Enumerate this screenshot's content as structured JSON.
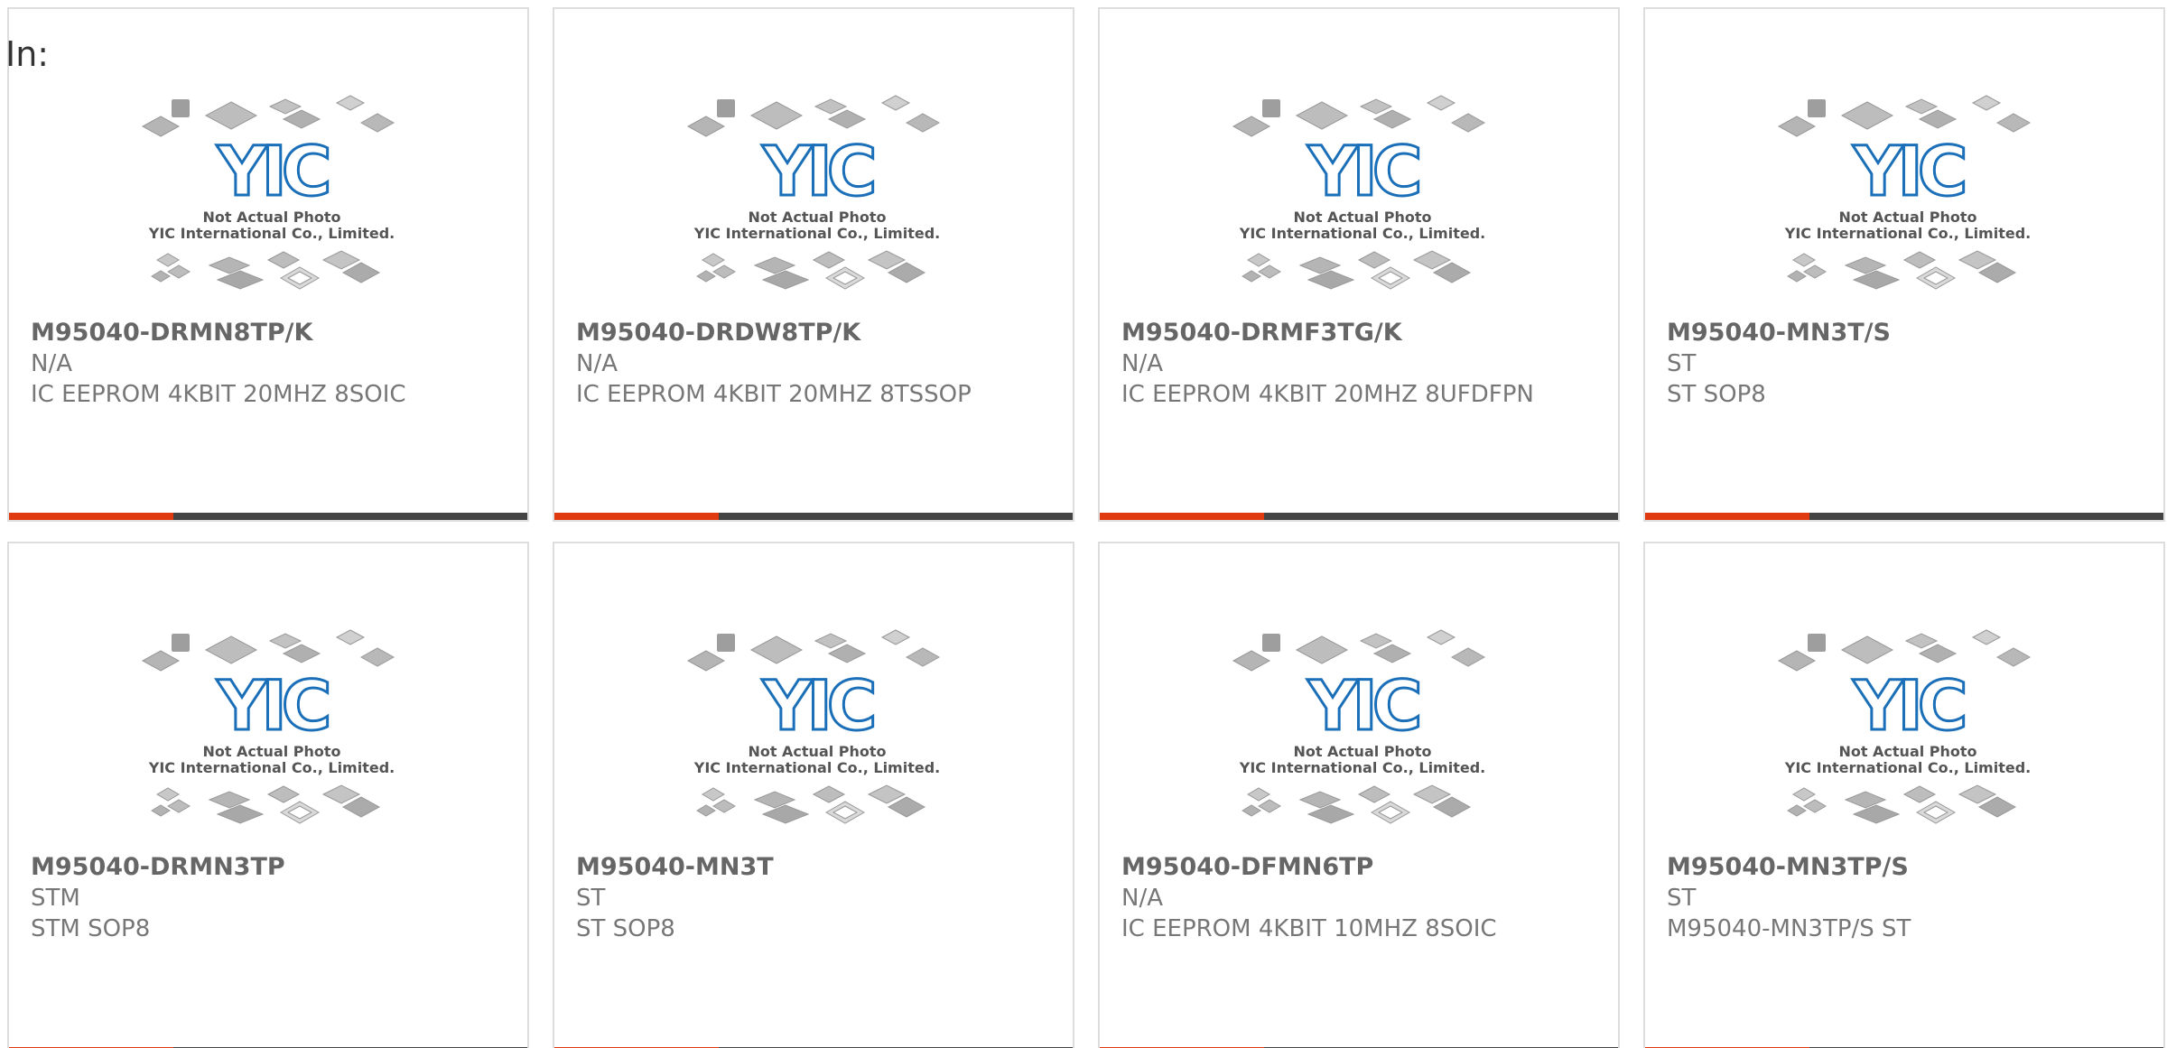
{
  "header": {
    "in_label": "In:"
  },
  "photo_caption": {
    "line1": "Not Actual Photo",
    "line2": "YIC International Co., Limited.",
    "logo": "YIC"
  },
  "colors": {
    "accent": "#e03a10",
    "bar": "#444444",
    "logo_blue": "#1a6fb8",
    "text": "#666666"
  },
  "products": [
    {
      "part": "M95040-DRMN8TP/K",
      "maker": "N/A",
      "desc": "IC EEPROM 4KBIT 20MHZ 8SOIC"
    },
    {
      "part": "M95040-DRDW8TP/K",
      "maker": "N/A",
      "desc": "IC EEPROM 4KBIT 20MHZ 8TSSOP"
    },
    {
      "part": "M95040-DRMF3TG/K",
      "maker": "N/A",
      "desc": "IC EEPROM 4KBIT 20MHZ 8UFDFPN"
    },
    {
      "part": "M95040-MN3T/S",
      "maker": "ST",
      "desc": "ST SOP8"
    },
    {
      "part": "M95040-DRMN3TP",
      "maker": "STM",
      "desc": "STM SOP8"
    },
    {
      "part": "M95040-MN3T",
      "maker": "ST",
      "desc": "ST SOP8"
    },
    {
      "part": "M95040-DFMN6TP",
      "maker": "N/A",
      "desc": "IC EEPROM 4KBIT 10MHZ 8SOIC"
    },
    {
      "part": "M95040-MN3TP/S",
      "maker": "ST",
      "desc": "M95040-MN3TP/S ST"
    }
  ]
}
